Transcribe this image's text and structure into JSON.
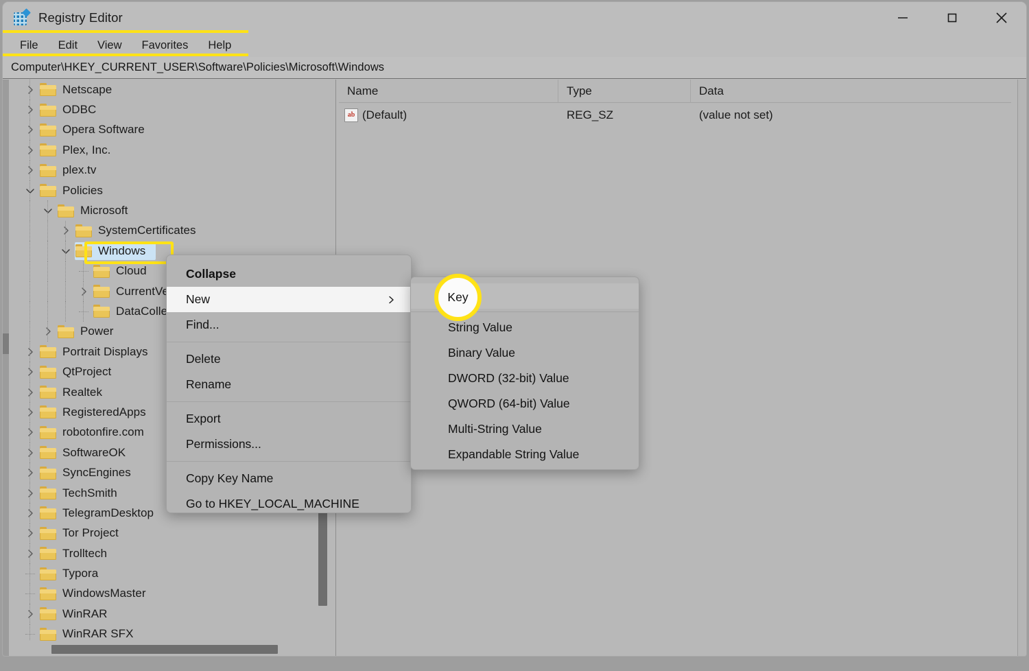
{
  "window": {
    "title": "Registry Editor",
    "app_icon": "registry-icon",
    "controls": {
      "minimize": "minimize-icon",
      "maximize": "maximize-icon",
      "close": "close-icon"
    }
  },
  "menubar": {
    "items": [
      "File",
      "Edit",
      "View",
      "Favorites",
      "Help"
    ]
  },
  "address": {
    "path": "Computer\\HKEY_CURRENT_USER\\Software\\Policies\\Microsoft\\Windows"
  },
  "tree": {
    "items": [
      {
        "label": "Netscape",
        "indent": 0,
        "twisty": "chevron-right",
        "selected": false
      },
      {
        "label": "ODBC",
        "indent": 0,
        "twisty": "chevron-right",
        "selected": false
      },
      {
        "label": "Opera Software",
        "indent": 0,
        "twisty": "chevron-right",
        "selected": false
      },
      {
        "label": "Plex, Inc.",
        "indent": 0,
        "twisty": "chevron-right",
        "selected": false
      },
      {
        "label": "plex.tv",
        "indent": 0,
        "twisty": "chevron-right",
        "selected": false
      },
      {
        "label": "Policies",
        "indent": 0,
        "twisty": "chevron-down",
        "selected": false
      },
      {
        "label": "Microsoft",
        "indent": 1,
        "twisty": "chevron-down",
        "selected": false
      },
      {
        "label": "SystemCertificates",
        "indent": 2,
        "twisty": "chevron-right",
        "selected": false
      },
      {
        "label": "Windows",
        "indent": 2,
        "twisty": "chevron-down",
        "selected": true
      },
      {
        "label": "Cloud",
        "indent": 3,
        "twisty": "none",
        "selected": false
      },
      {
        "label": "CurrentVersion",
        "indent": 3,
        "twisty": "chevron-right",
        "selected": false
      },
      {
        "label": "DataCollection",
        "indent": 3,
        "twisty": "none",
        "selected": false
      },
      {
        "label": "Power",
        "indent": 1,
        "twisty": "chevron-right",
        "selected": false
      },
      {
        "label": "Portrait Displays",
        "indent": 0,
        "twisty": "chevron-right",
        "selected": false
      },
      {
        "label": "QtProject",
        "indent": 0,
        "twisty": "chevron-right",
        "selected": false
      },
      {
        "label": "Realtek",
        "indent": 0,
        "twisty": "chevron-right",
        "selected": false
      },
      {
        "label": "RegisteredApps",
        "indent": 0,
        "twisty": "chevron-right",
        "selected": false
      },
      {
        "label": "robotonfire.com",
        "indent": 0,
        "twisty": "chevron-right",
        "selected": false
      },
      {
        "label": "SoftwareOK",
        "indent": 0,
        "twisty": "chevron-right",
        "selected": false
      },
      {
        "label": "SyncEngines",
        "indent": 0,
        "twisty": "chevron-right",
        "selected": false
      },
      {
        "label": "TechSmith",
        "indent": 0,
        "twisty": "chevron-right",
        "selected": false
      },
      {
        "label": "TelegramDesktop",
        "indent": 0,
        "twisty": "chevron-right",
        "selected": false
      },
      {
        "label": "Tor Project",
        "indent": 0,
        "twisty": "chevron-right",
        "selected": false
      },
      {
        "label": "Trolltech",
        "indent": 0,
        "twisty": "chevron-right",
        "selected": false
      },
      {
        "label": "Typora",
        "indent": 0,
        "twisty": "none",
        "selected": false
      },
      {
        "label": "WindowsMaster",
        "indent": 0,
        "twisty": "none",
        "selected": false
      },
      {
        "label": "WinRAR",
        "indent": 0,
        "twisty": "chevron-right",
        "selected": false
      },
      {
        "label": "WinRAR SFX",
        "indent": 0,
        "twisty": "none",
        "selected": false
      }
    ]
  },
  "values": {
    "columns": [
      "Name",
      "Type",
      "Data"
    ],
    "rows": [
      {
        "name": "(Default)",
        "icon": "string-value-icon",
        "type": "REG_SZ",
        "data": "(value not set)"
      }
    ]
  },
  "context_menu": {
    "items": [
      {
        "label": "Collapse",
        "bold": true,
        "submenu": false,
        "highlighted": false,
        "sep_after": false
      },
      {
        "label": "New",
        "bold": false,
        "submenu": true,
        "highlighted": true,
        "sep_after": false
      },
      {
        "label": "Find...",
        "bold": false,
        "submenu": false,
        "highlighted": false,
        "sep_after": true
      },
      {
        "label": "Delete",
        "bold": false,
        "submenu": false,
        "highlighted": false,
        "sep_after": false
      },
      {
        "label": "Rename",
        "bold": false,
        "submenu": false,
        "highlighted": false,
        "sep_after": true
      },
      {
        "label": "Export",
        "bold": false,
        "submenu": false,
        "highlighted": false,
        "sep_after": false
      },
      {
        "label": "Permissions...",
        "bold": false,
        "submenu": false,
        "highlighted": false,
        "sep_after": true
      },
      {
        "label": "Copy Key Name",
        "bold": false,
        "submenu": false,
        "highlighted": false,
        "sep_after": false
      },
      {
        "label": "Go to HKEY_LOCAL_MACHINE",
        "bold": false,
        "submenu": false,
        "highlighted": false,
        "sep_after": false
      }
    ]
  },
  "submenu": {
    "items": [
      {
        "label": "Key",
        "sep_after": true
      },
      {
        "label": "String Value",
        "sep_after": false
      },
      {
        "label": "Binary Value",
        "sep_after": false
      },
      {
        "label": "DWORD (32-bit) Value",
        "sep_after": false
      },
      {
        "label": "QWORD (64-bit) Value",
        "sep_after": false
      },
      {
        "label": "Multi-String Value",
        "sep_after": false
      },
      {
        "label": "Expandable String Value",
        "sep_after": false
      }
    ]
  },
  "annotations": {
    "tree_highlight_label": "Windows",
    "menu_highlight_label": "New",
    "circle_highlight_label": "Key",
    "accent_color": "#ffe216"
  }
}
